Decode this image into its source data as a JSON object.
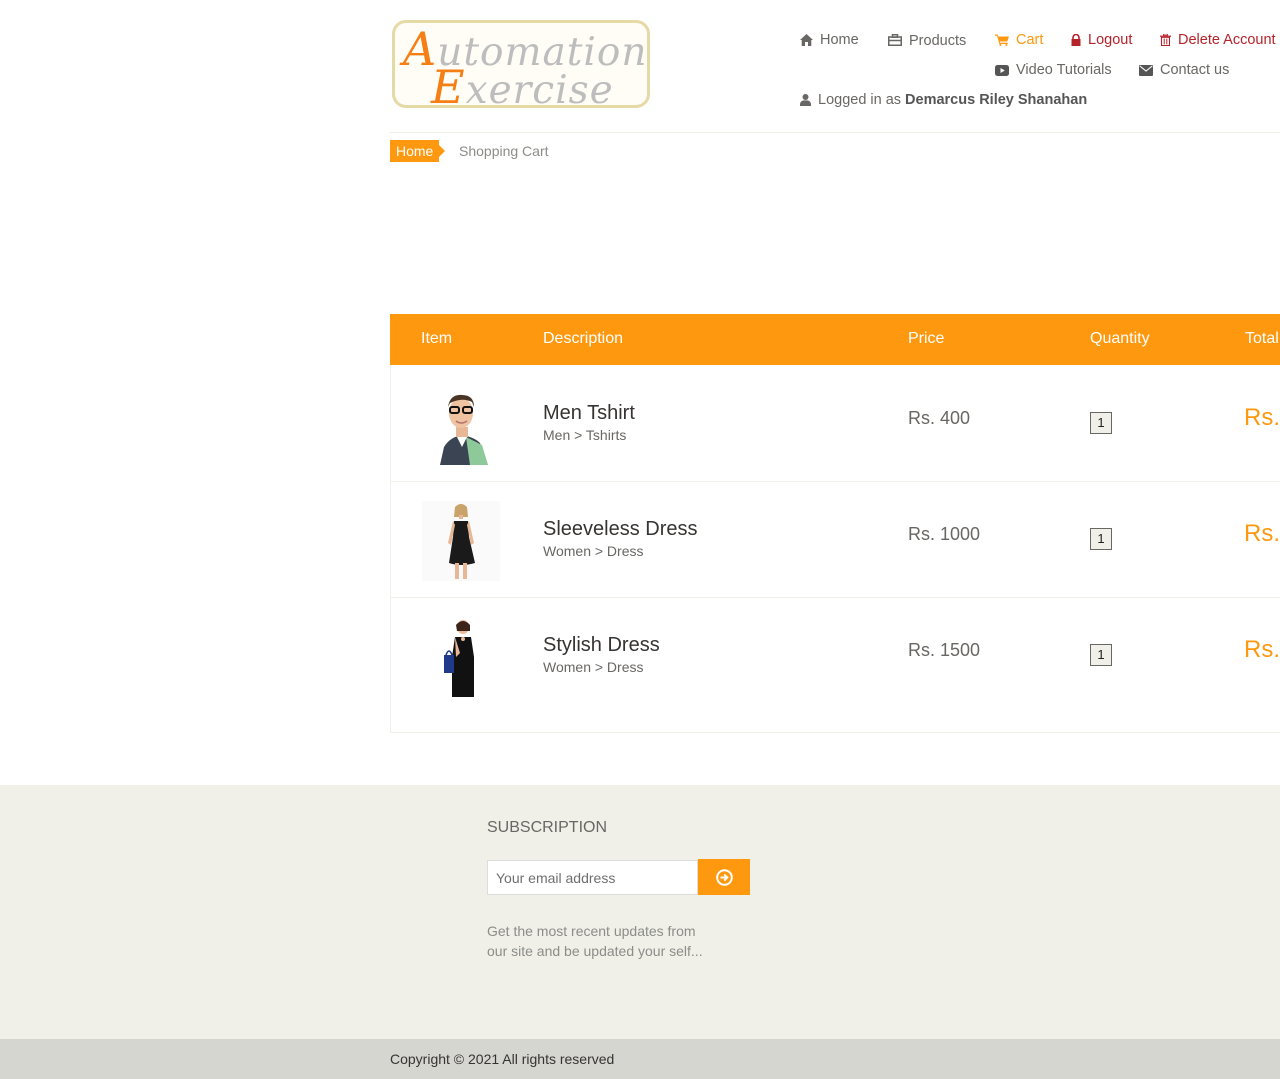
{
  "logo": {
    "line1_cap": "A",
    "line1_rest": "utomation",
    "line2_cap": "E",
    "line2_rest": "xercise"
  },
  "nav": {
    "home": "Home",
    "products": "Products",
    "cart": "Cart",
    "logout": "Logout",
    "delete_account": "Delete Account",
    "video_tutorials": "Video Tutorials",
    "contact_us": "Contact us",
    "logged_in_prefix": "Logged in as",
    "username": "Demarcus Riley Shanahan"
  },
  "icons": {
    "home": "home-icon",
    "products": "briefcase-icon",
    "cart": "shopping-cart-icon",
    "logout": "lock-icon",
    "delete": "trash-icon",
    "video": "youtube-play-icon",
    "contact": "envelope-icon",
    "user": "user-icon",
    "subscribe": "arrow-circle-right-icon"
  },
  "colors": {
    "accent": "#FE980F",
    "danger": "#b5232a",
    "footer_bg": "#f0f0e9"
  },
  "breadcrumb": {
    "home": "Home",
    "current": "Shopping Cart"
  },
  "cart_table": {
    "headers": {
      "item": "Item",
      "description": "Description",
      "price": "Price",
      "quantity": "Quantity",
      "total": "Total"
    },
    "rows": [
      {
        "name": "Men Tshirt",
        "category": "Men > Tshirts",
        "price": "Rs. 400",
        "quantity": "1",
        "total": "Rs."
      },
      {
        "name": "Sleeveless Dress",
        "category": "Women > Dress",
        "price": "Rs. 1000",
        "quantity": "1",
        "total": "Rs."
      },
      {
        "name": "Stylish Dress",
        "category": "Women > Dress",
        "price": "Rs. 1500",
        "quantity": "1",
        "total": "Rs."
      }
    ]
  },
  "subscription": {
    "title": "SUBSCRIPTION",
    "placeholder": "Your email address",
    "description": "Get the most recent updates from our site and be updated your self..."
  },
  "footer": {
    "copyright": "Copyright © 2021 All rights reserved"
  }
}
